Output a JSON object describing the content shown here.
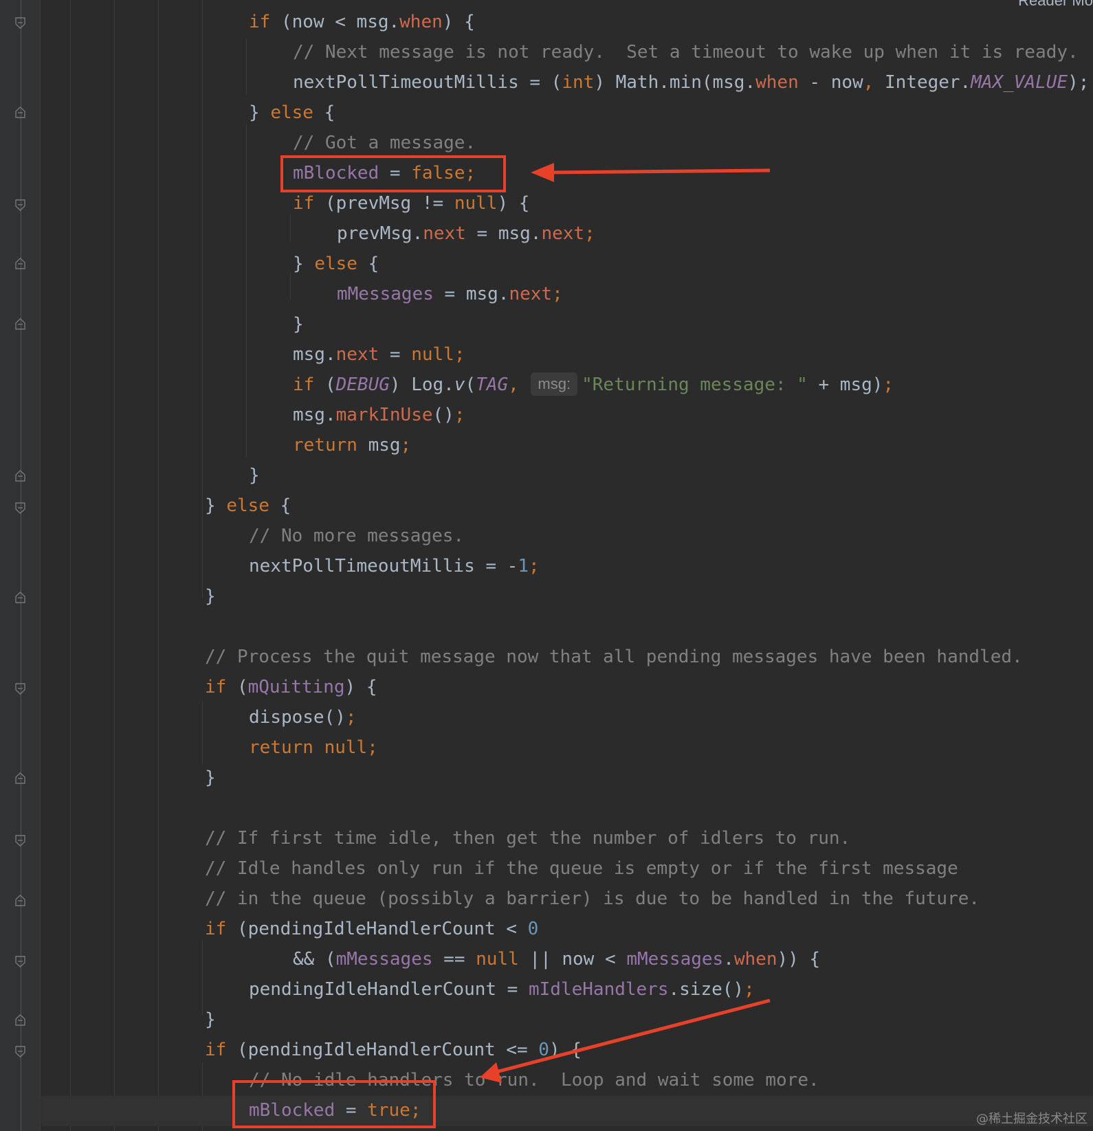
{
  "toolbar": {
    "reader_mode_label": "Reader Mo"
  },
  "watermark": "@稀土掘金技术社区",
  "code": {
    "l01": {
      "a": "if",
      "b": " (now < msg.",
      "c": "when",
      "d": ") {"
    },
    "l02": {
      "a": "// Next message is not ready.  Set a timeout to wake up when it is ready."
    },
    "l03": {
      "a": "nextPollTimeoutMillis = (",
      "b": "int",
      "c": ") Math.min(msg.",
      "d": "when",
      "e": " - now",
      "f": ", ",
      "g": "Integer.",
      "h": "MAX_VALUE",
      "i": ");"
    },
    "l04": {
      "a": "} ",
      "b": "else",
      "c": " {"
    },
    "l05": {
      "a": "// Got a message."
    },
    "l06": {
      "a": "mBlocked",
      "b": " = ",
      "c": "false;"
    },
    "l07": {
      "a": "if",
      "b": " (prevMsg != ",
      "c": "null",
      "d": ") {"
    },
    "l08": {
      "a": "prevMsg.",
      "b": "next",
      "c": " = msg.",
      "d": "next",
      "e": ";"
    },
    "l09": {
      "a": "} ",
      "b": "else",
      "c": " {"
    },
    "l10": {
      "a": "mMessages",
      "b": " = msg.",
      "c": "next",
      "d": ";"
    },
    "l11": {
      "a": "}"
    },
    "l12": {
      "a": "msg.",
      "b": "next",
      "c": " = ",
      "d": "null;"
    },
    "l13": {
      "a": "if",
      "b": " (",
      "c": "DEBUG",
      "d": ") Log.",
      "e": "v",
      "f": "(",
      "g": "TAG",
      "h": ",",
      "hint": "msg:",
      "i": "\"Returning message: \"",
      "j": " + msg)",
      "k": ";"
    },
    "l14": {
      "a": "msg.",
      "b": "markInUse",
      "c": "()",
      "d": ";"
    },
    "l15": {
      "a": "return",
      "b": " msg",
      "c": ";"
    },
    "l16": {
      "a": "}"
    },
    "l17": {
      "a": "} ",
      "b": "else",
      "c": " {"
    },
    "l18": {
      "a": "// No more messages."
    },
    "l19": {
      "a": "nextPollTimeoutMillis = -",
      "b": "1",
      "c": ";"
    },
    "l20": {
      "a": "}"
    },
    "l21": {
      "a": "// Process the quit message now that all pending messages have been handled."
    },
    "l22": {
      "a": "if",
      "b": " (",
      "c": "mQuitting",
      "d": ") {"
    },
    "l23": {
      "a": "dispose()",
      "b": ";"
    },
    "l24": {
      "a": "return null;"
    },
    "l25": {
      "a": "}"
    },
    "l26": {
      "a": "// If first time idle, then get the number of idlers to run."
    },
    "l27": {
      "a": "// Idle handles only run if the queue is empty or if the first message"
    },
    "l28": {
      "a": "// in the queue (possibly a barrier) is due to be handled in the future."
    },
    "l29": {
      "a": "if",
      "b": " (pendingIdleHandlerCount < ",
      "c": "0"
    },
    "l30": {
      "a": "&& (",
      "b": "mMessages",
      "c": " == ",
      "d": "null",
      "e": " || now < ",
      "f": "mMessages",
      "g": ".",
      "h": "when",
      "i": ")) {"
    },
    "l31": {
      "a": "pendingIdleHandlerCount = ",
      "b": "mIdleHandlers",
      "c": ".size()",
      "d": ";"
    },
    "l32": {
      "a": "}"
    },
    "l33": {
      "a": "if",
      "b": " (pendingIdleHandlerCount <= ",
      "c": "0",
      "d": ") {"
    },
    "l34": {
      "a": "// No idle handlers to run.  Loop and wait some more."
    },
    "l35": {
      "a": "mBlocked",
      "b": " = ",
      "c": "true;"
    }
  },
  "annotation_color": "#e7412a",
  "syntax_colors": {
    "keyword": "#cc7832",
    "field": "#9876aa",
    "member": "#cf6a4c",
    "comment": "#808080",
    "string": "#6a8759",
    "number": "#6897bb",
    "text": "#a9b7c6"
  }
}
